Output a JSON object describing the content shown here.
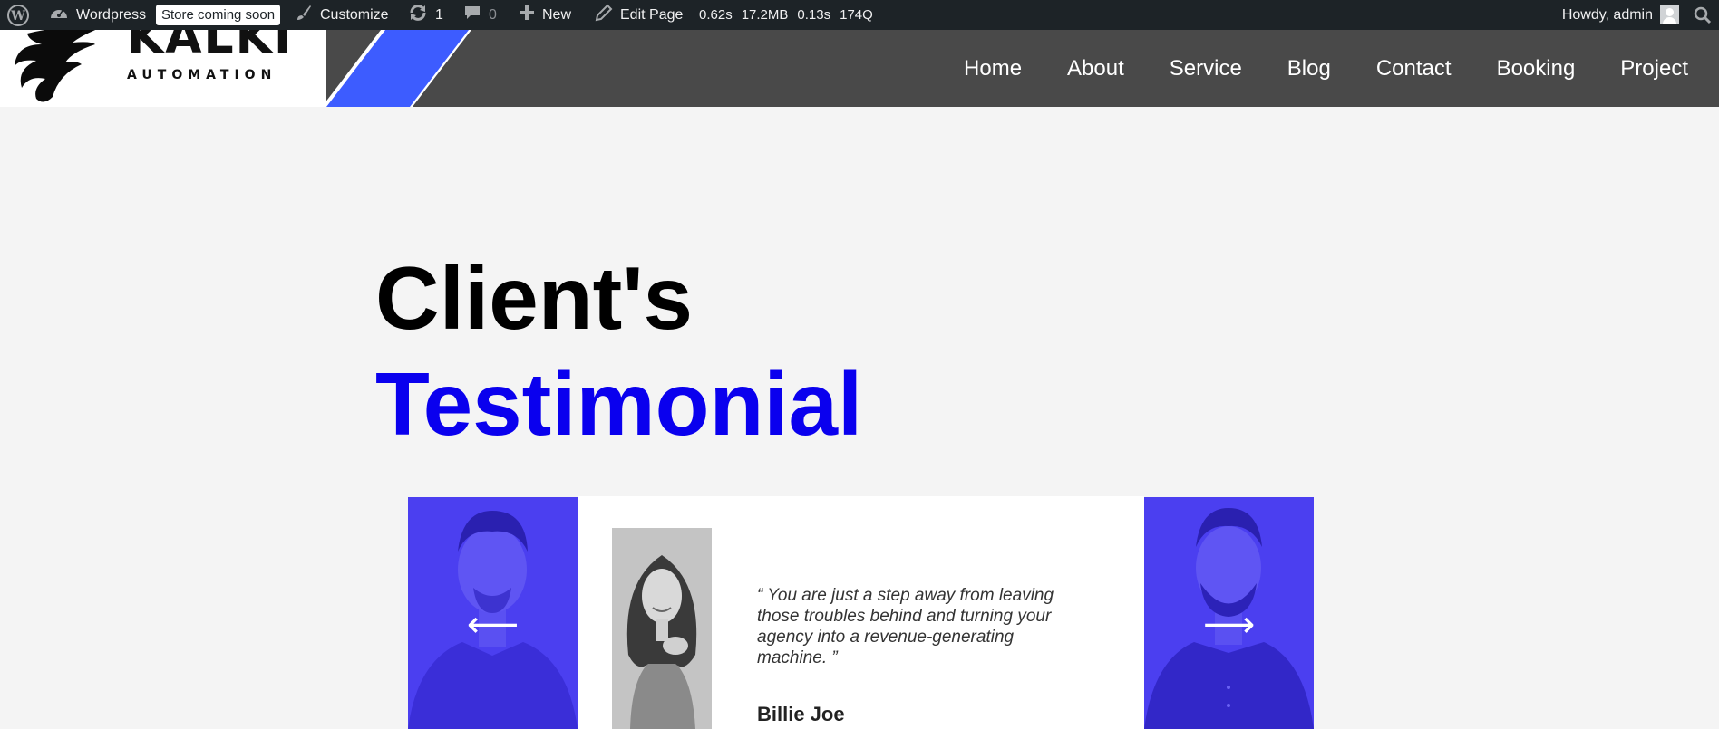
{
  "admin_bar": {
    "site_name": "Wordpress",
    "store_badge": "Store coming soon",
    "customize": "Customize",
    "updates_count": "1",
    "comments_count": "0",
    "new_label": "New",
    "edit_page": "Edit Page",
    "perf": [
      "0.62s",
      "17.2MB",
      "0.13s",
      "174Q"
    ],
    "greeting": "Howdy, admin"
  },
  "header": {
    "logo_text": "KALKI",
    "logo_subtext": "AUTOMATION",
    "nav": [
      "Home",
      "About",
      "Service",
      "Blog",
      "Contact",
      "Booking",
      "Project"
    ]
  },
  "section": {
    "heading_line1": "Client's",
    "heading_line2": "Testimonial"
  },
  "testimonial": {
    "quote": "“ You are just a step away from leaving those troubles behind and turning your agency into a revenue-generating machine. ”",
    "author": "Billie Joe",
    "prev_arrow": "⟵",
    "next_arrow": "⟶"
  },
  "colors": {
    "accent_blue": "#0a00ee",
    "card_blue": "#4b3ff0",
    "slash_blue": "#3d5cff",
    "header_gray": "#494949",
    "admin_bar": "#1d2327"
  }
}
